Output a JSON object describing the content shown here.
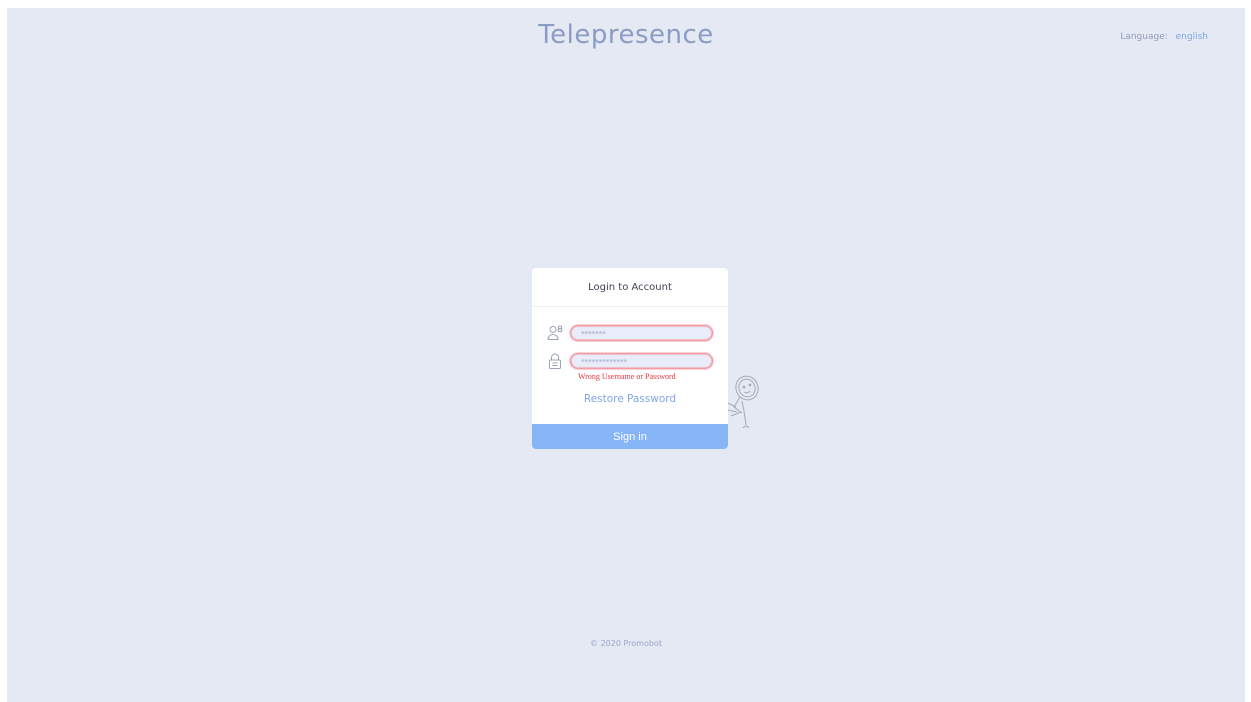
{
  "header": {
    "title": "Telepresence",
    "language_label": "Language:",
    "language_value": "english"
  },
  "login": {
    "title": "Login to Account",
    "username_value": "•••••••",
    "password_value": "•••••••••••••",
    "error": "Wrong Username or Password",
    "restore_label": "Restore Password",
    "signin_label": "Sign in"
  },
  "footer": {
    "copyright": "© 2020 Promobot"
  },
  "colors": {
    "background": "#e4e9f4",
    "title": "#8c9bc6",
    "link": "#7fa6e6",
    "signin_button": "#85b5f5",
    "error": "#e5363e"
  },
  "icons": [
    "user-icon",
    "lock-icon",
    "robot-mascot-icon"
  ]
}
